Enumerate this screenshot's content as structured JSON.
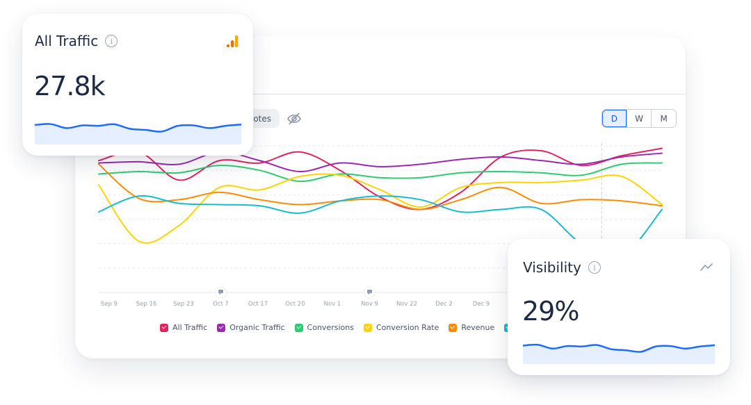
{
  "main_card": {
    "notes_label": "otes",
    "hide_icon": "eye-off-icon",
    "period_buttons": [
      {
        "label": "D",
        "active": true
      },
      {
        "label": "W",
        "active": false
      },
      {
        "label": "M",
        "active": false
      }
    ]
  },
  "chart_data": {
    "type": "line",
    "title": "",
    "xlabel": "",
    "ylabel": "",
    "grid": true,
    "legend_position": "bottom",
    "x": [
      "Sep 9",
      "Sep 16",
      "Sep 23",
      "Oct 7",
      "Oct 17",
      "Oct 20",
      "Nov 1",
      "Nov 9",
      "Nov 22",
      "Dec 2",
      "Dec 9",
      "",
      "",
      "",
      ""
    ],
    "x_tick_labels": [
      "Sep 9",
      "Sep 16",
      "Sep 23",
      "Oct 7",
      "Oct 17",
      "Oct 20",
      "Nov 1",
      "Nov 9",
      "Nov 22",
      "Dec 2",
      "Dec 9"
    ],
    "annotations": [
      {
        "type": "note-marker",
        "at": "Oct 7"
      },
      {
        "type": "note-marker",
        "at": "Nov 9"
      },
      {
        "type": "vertical-dashed-line",
        "at_index": 12.5
      }
    ],
    "ylim": [
      0,
      100
    ],
    "series": [
      {
        "name": "All Traffic",
        "color": "#e0245e",
        "values": [
          88,
          95,
          72,
          88,
          86,
          95,
          80,
          58,
          48,
          62,
          91,
          96,
          84,
          92,
          98
        ]
      },
      {
        "name": "Organic Traffic",
        "color": "#9c27b0",
        "values": [
          86,
          87,
          85,
          95,
          88,
          79,
          86,
          83,
          85,
          89,
          91,
          88,
          85,
          91,
          94
        ]
      },
      {
        "name": "Conversions",
        "color": "#2ecc71",
        "values": [
          77,
          79,
          78,
          84,
          80,
          71,
          77,
          74,
          74,
          78,
          79,
          78,
          76,
          85,
          86
        ]
      },
      {
        "name": "Conversion Rate",
        "color": "#ffd400",
        "values": [
          68,
          22,
          35,
          66,
          64,
          75,
          76,
          64,
          50,
          66,
          70,
          70,
          72,
          75,
          52
        ]
      },
      {
        "name": "Revenue",
        "color": "#ff8c00",
        "values": [
          85,
          57,
          56,
          62,
          56,
          52,
          55,
          56,
          48,
          56,
          66,
          53,
          56,
          55,
          51
        ]
      },
      {
        "name": "",
        "color": "#17bcd0",
        "values": [
          46,
          59,
          53,
          52,
          51,
          45,
          55,
          59,
          56,
          46,
          48,
          48,
          20,
          10,
          48
        ]
      }
    ]
  },
  "legend": [
    {
      "label": "All Traffic",
      "color": "#e0245e"
    },
    {
      "label": "Organic Traffic",
      "color": "#9c27b0"
    },
    {
      "label": "Conversions",
      "color": "#2ecc71"
    },
    {
      "label": "Conversion Rate",
      "color": "#ffd400"
    },
    {
      "label": "Revenue",
      "color": "#ff8c00"
    },
    {
      "label": "",
      "color": "#17bcd0"
    }
  ],
  "kpi_traffic": {
    "title": "All Traffic",
    "info_icon": "i",
    "value": "27.8k",
    "icon": "google-analytics-icon",
    "sparkline": [
      62,
      66,
      48,
      60,
      58,
      65,
      45,
      40,
      33,
      58,
      60,
      48,
      58,
      64
    ],
    "line_color": "#1e6bff",
    "fill_color": "#e6efff"
  },
  "kpi_visibility": {
    "title": "Visibility",
    "info_icon": "i",
    "value": "29%",
    "icon": "trend-icon",
    "sparkline": [
      62,
      66,
      48,
      60,
      58,
      65,
      45,
      40,
      33,
      58,
      60,
      48,
      58,
      64
    ],
    "line_color": "#1e6bff",
    "fill_color": "#e6efff"
  }
}
